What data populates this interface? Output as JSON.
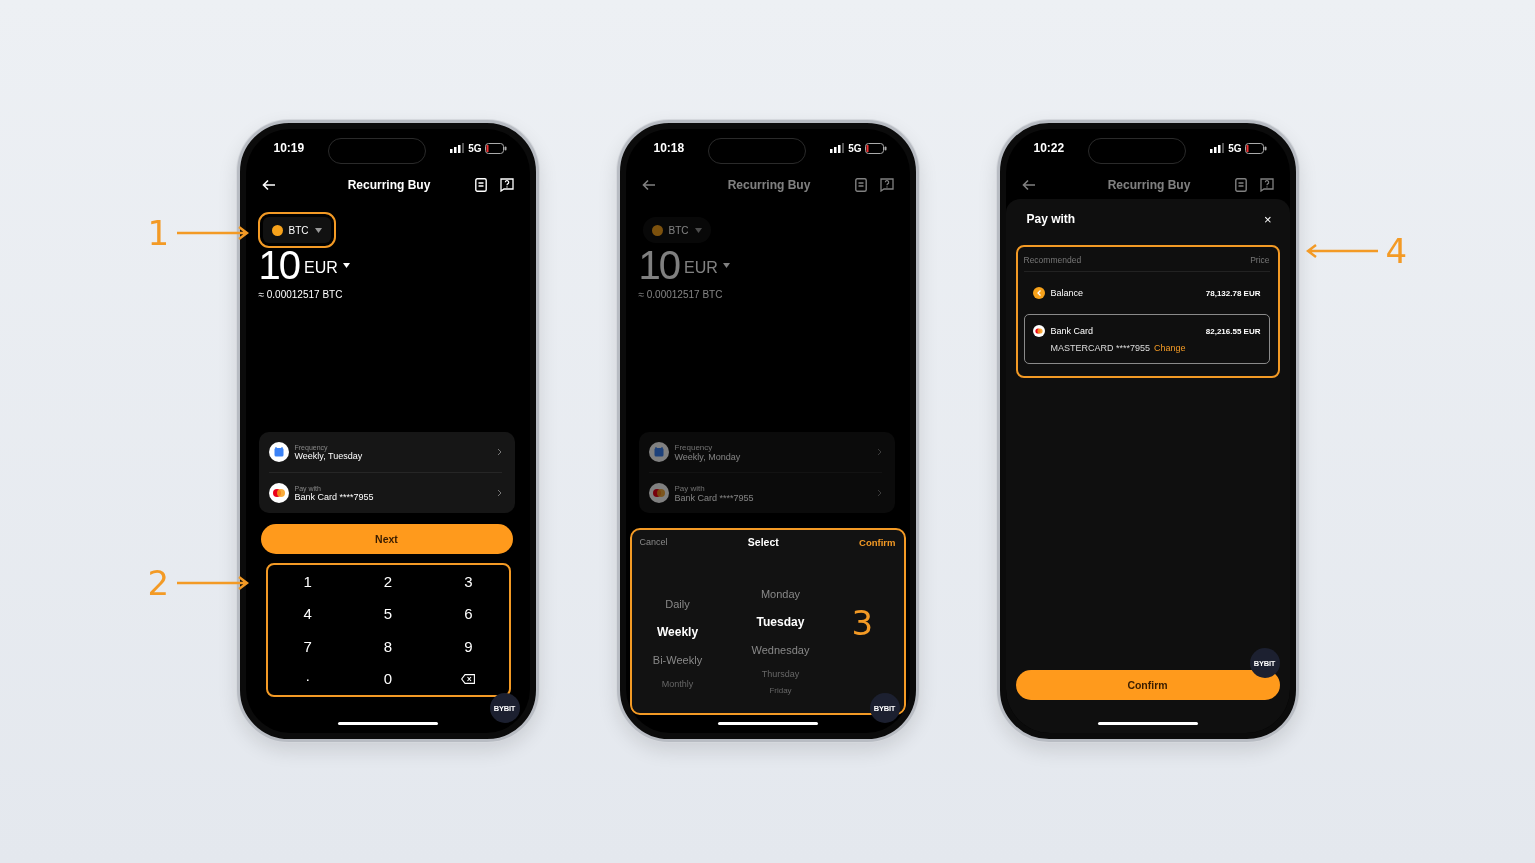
{
  "phones": [
    {
      "time": "10:19",
      "network": "5G",
      "title": "Recurring Buy",
      "dimmed": false,
      "asset": "BTC",
      "asset_highlighted": true,
      "amount": "10",
      "currency": "EUR",
      "estimate": "≈ 0.00012517 BTC",
      "settings": [
        {
          "kind": "frequency",
          "label": "Frequency",
          "value": "Weekly, Tuesday"
        },
        {
          "kind": "card",
          "label": "Pay with",
          "value": "Bank Card ****7955"
        }
      ],
      "panel": {
        "kind": "keypad",
        "highlighted": true,
        "button": "Next",
        "keys": [
          {
            "kind": "digit",
            "label": "1"
          },
          {
            "kind": "digit",
            "label": "2"
          },
          {
            "kind": "digit",
            "label": "3"
          },
          {
            "kind": "digit",
            "label": "4"
          },
          {
            "kind": "digit",
            "label": "5"
          },
          {
            "kind": "digit",
            "label": "6"
          },
          {
            "kind": "digit",
            "label": "7"
          },
          {
            "kind": "digit",
            "label": "8"
          },
          {
            "kind": "digit",
            "label": "9"
          },
          {
            "kind": "digit",
            "label": "·"
          },
          {
            "kind": "digit",
            "label": "0"
          },
          {
            "kind": "delete"
          }
        ]
      },
      "badge": "BYBIT",
      "callouts": [
        {
          "label": "1",
          "kind": "asset_left"
        },
        {
          "label": "2",
          "kind": "panel_left"
        }
      ]
    },
    {
      "time": "10:18",
      "network": "5G",
      "title": "Recurring Buy",
      "dimmed": true,
      "asset": "BTC",
      "asset_highlighted": false,
      "amount": "10",
      "currency": "EUR",
      "estimate": "≈ 0.00012517 BTC",
      "settings": [
        {
          "kind": "frequency",
          "label": "Frequency",
          "value": "Weekly, Monday"
        },
        {
          "kind": "card",
          "label": "Pay with",
          "value": "Bank Card ****7955"
        }
      ],
      "panel": {
        "kind": "picker",
        "highlighted": true,
        "cancel": "Cancel",
        "title": "Select",
        "confirm": "Confirm",
        "columns": [
          [
            {
              "label": "Daily",
              "selected": false
            },
            {
              "label": "Weekly",
              "selected": true
            },
            {
              "label": "Bi-Weekly",
              "selected": false
            },
            {
              "label": "Monthly",
              "selected": false
            }
          ],
          [
            {
              "label": "Monday",
              "selected": false
            },
            {
              "label": "Tuesday",
              "selected": true
            },
            {
              "label": "Wednesday",
              "selected": false
            },
            {
              "label": "Thursday",
              "selected": false
            },
            {
              "label": "Friday",
              "selected": false
            }
          ]
        ]
      },
      "badge": "BYBIT",
      "callouts": [
        {
          "label": "3",
          "kind": "panel_inside"
        }
      ]
    },
    {
      "time": "10:22",
      "network": "5G",
      "title": "Recurring Buy",
      "dimmed": true,
      "panel": {
        "kind": "pay_sheet",
        "highlighted": true,
        "title": "Pay with",
        "close": "×",
        "header_left": "Recommended",
        "header_right": "Price",
        "methods": [
          {
            "kind": "balance",
            "name": "Balance",
            "price": "78,132.78 EUR",
            "selected": false
          },
          {
            "kind": "card",
            "name": "Bank Card",
            "price": "82,216.55 EUR",
            "detail": "MASTERCARD ****7955",
            "action": "Change",
            "selected": true
          }
        ],
        "button": "Confirm"
      },
      "badge": "BYBIT",
      "callouts": [
        {
          "label": "4",
          "kind": "panel_right"
        }
      ]
    }
  ]
}
